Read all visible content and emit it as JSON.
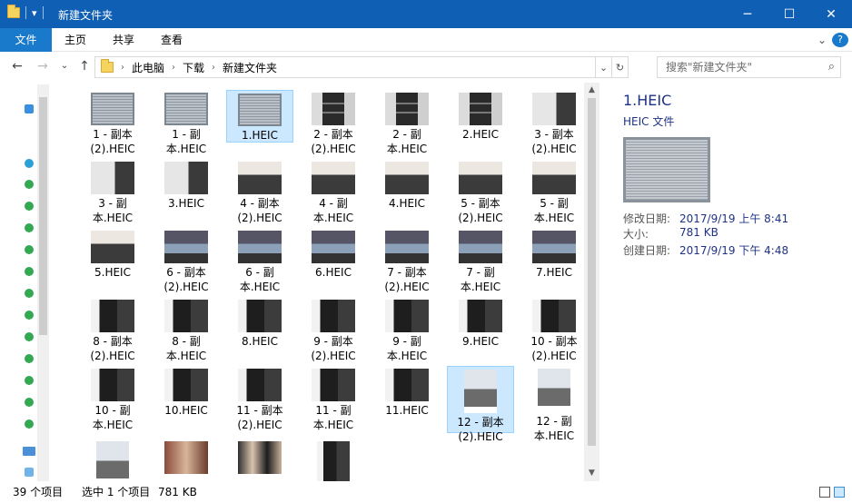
{
  "window": {
    "title": "新建文件夹",
    "controls": {
      "minimize": "─",
      "maximize": "☐",
      "close": "✕"
    },
    "dropdown_glyph": "▾"
  },
  "ribbon": {
    "tabs": [
      "文件",
      "主页",
      "共享",
      "查看"
    ],
    "expand_glyph": "⌄",
    "help_glyph": "?"
  },
  "nav": {
    "back": "←",
    "forward": "→",
    "recent": "⌄",
    "up": "↑"
  },
  "address": {
    "crumbs": [
      "此电脑",
      "下载",
      "新建文件夹"
    ],
    "sep": "›",
    "dropdown": "⌄",
    "refresh": "↻"
  },
  "search": {
    "placeholder": "搜索\"新建文件夹\"",
    "icon": "search-icon",
    "glyph": "⌕"
  },
  "files": [
    {
      "label": "1 - 副本 (2).HEIC",
      "thumb": "door"
    },
    {
      "label": "1 - 副本.HEIC",
      "thumb": "door"
    },
    {
      "label": "1.HEIC",
      "thumb": "door",
      "selected": true
    },
    {
      "label": "2 - 副本 (2).HEIC",
      "thumb": "shelf"
    },
    {
      "label": "2 - 副本.HEIC",
      "thumb": "shelf"
    },
    {
      "label": "2.HEIC",
      "thumb": "shelf"
    },
    {
      "label": "3 - 副本 (2).HEIC",
      "thumb": "wall"
    },
    {
      "label": "3 - 副本.HEIC",
      "thumb": "wall"
    },
    {
      "label": "3.HEIC",
      "thumb": "wall"
    },
    {
      "label": "4 - 副本 (2).HEIC",
      "thumb": "room"
    },
    {
      "label": "4 - 副本.HEIC",
      "thumb": "room"
    },
    {
      "label": "4.HEIC",
      "thumb": "room"
    },
    {
      "label": "5 - 副本 (2).HEIC",
      "thumb": "room"
    },
    {
      "label": "5 - 副本.HEIC",
      "thumb": "room"
    },
    {
      "label": "5.HEIC",
      "thumb": "room"
    },
    {
      "label": "6 - 副本 (2).HEIC",
      "thumb": "bike"
    },
    {
      "label": "6 - 副本.HEIC",
      "thumb": "bike"
    },
    {
      "label": "6.HEIC",
      "thumb": "bike"
    },
    {
      "label": "7 - 副本 (2).HEIC",
      "thumb": "bike"
    },
    {
      "label": "7 - 副本.HEIC",
      "thumb": "bike"
    },
    {
      "label": "7.HEIC",
      "thumb": "bike"
    },
    {
      "label": "8 - 副本 (2).HEIC",
      "thumb": "racks"
    },
    {
      "label": "8 - 副本.HEIC",
      "thumb": "racks"
    },
    {
      "label": "8.HEIC",
      "thumb": "racks"
    },
    {
      "label": "9 - 副本 (2).HEIC",
      "thumb": "racks"
    },
    {
      "label": "9 - 副本.HEIC",
      "thumb": "racks"
    },
    {
      "label": "9.HEIC",
      "thumb": "racks"
    },
    {
      "label": "10 - 副本 (2).HEIC",
      "thumb": "racks"
    },
    {
      "label": "10 - 副本.HEIC",
      "thumb": "racks"
    },
    {
      "label": "10.HEIC",
      "thumb": "racks"
    },
    {
      "label": "11 - 副本 (2).HEIC",
      "thumb": "racks"
    },
    {
      "label": "11 - 副本.HEIC",
      "thumb": "racks"
    },
    {
      "label": "11.HEIC",
      "thumb": "racks"
    },
    {
      "label": "12 - 副本 (2).HEIC",
      "thumb": "street",
      "portrait": true,
      "highlighted": true
    },
    {
      "label": "12 - 副本.HEIC",
      "thumb": "street",
      "portrait": true
    },
    {
      "label": "",
      "thumb": "street",
      "portrait": true
    },
    {
      "label": "",
      "thumb": "warm"
    },
    {
      "label": "",
      "thumb": "people"
    },
    {
      "label": "",
      "thumb": "racks",
      "portrait": true
    }
  ],
  "preview": {
    "name": "1.HEIC",
    "type": "HEIC 文件",
    "modified_label": "修改日期:",
    "modified_value": "2017/9/19 上午 8:41",
    "size_label": "大小:",
    "size_value": "781 KB",
    "created_label": "创建日期:",
    "created_value": "2017/9/19 下午 4:48"
  },
  "status": {
    "count": "39 个项目",
    "selection": "选中 1 个项目",
    "selection_size": "781 KB"
  },
  "colors": {
    "titlebar": "#0f5fb5",
    "file_tab": "#1979ca",
    "selection": "#cce8ff",
    "preview_text": "#1e3287"
  }
}
